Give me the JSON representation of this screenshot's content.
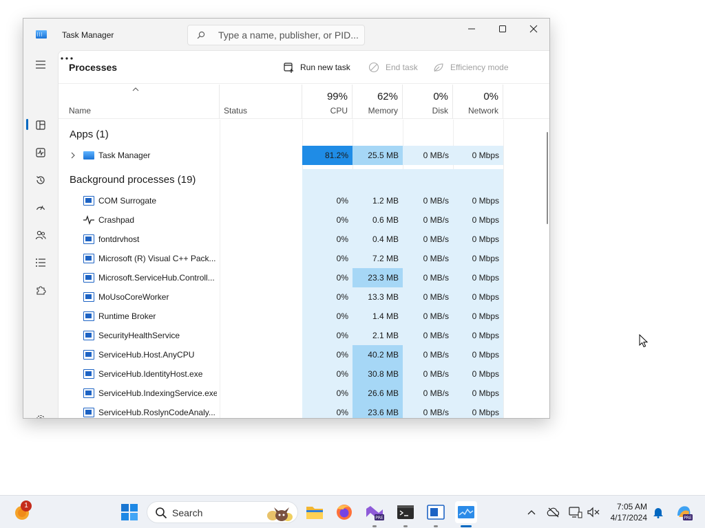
{
  "window": {
    "title": "Task Manager",
    "search_placeholder": "Type a name, publisher, or PID..."
  },
  "commandbar": {
    "page_title": "Processes",
    "run_new_task": "Run new task",
    "end_task": "End task",
    "efficiency_mode": "Efficiency mode"
  },
  "columns": {
    "name": "Name",
    "status": "Status",
    "cpu": {
      "pct": "99%",
      "label": "CPU"
    },
    "memory": {
      "pct": "62%",
      "label": "Memory"
    },
    "disk": {
      "pct": "0%",
      "label": "Disk"
    },
    "network": {
      "pct": "0%",
      "label": "Network"
    }
  },
  "groups": {
    "apps": "Apps (1)",
    "background": "Background processes (19)"
  },
  "apps": [
    {
      "name": "Task Manager",
      "cpu": "81.2%",
      "memory": "25.5 MB",
      "disk": "0 MB/s",
      "network": "0 Mbps"
    }
  ],
  "background": [
    {
      "name": "COM Surrogate",
      "cpu": "0%",
      "memory": "1.2 MB",
      "disk": "0 MB/s",
      "network": "0 Mbps",
      "icon": "process-icon"
    },
    {
      "name": "Crashpad",
      "cpu": "0%",
      "memory": "0.6 MB",
      "disk": "0 MB/s",
      "network": "0 Mbps",
      "icon": "pulse-icon"
    },
    {
      "name": "fontdrvhost",
      "cpu": "0%",
      "memory": "0.4 MB",
      "disk": "0 MB/s",
      "network": "0 Mbps",
      "icon": "process-icon"
    },
    {
      "name": "Microsoft (R) Visual C++ Pack...",
      "cpu": "0%",
      "memory": "7.2 MB",
      "disk": "0 MB/s",
      "network": "0 Mbps",
      "icon": "process-icon"
    },
    {
      "name": "Microsoft.ServiceHub.Controll...",
      "cpu": "0%",
      "memory": "23.3 MB",
      "disk": "0 MB/s",
      "network": "0 Mbps",
      "icon": "process-icon"
    },
    {
      "name": "MoUsoCoreWorker",
      "cpu": "0%",
      "memory": "13.3 MB",
      "disk": "0 MB/s",
      "network": "0 Mbps",
      "icon": "process-icon"
    },
    {
      "name": "Runtime Broker",
      "cpu": "0%",
      "memory": "1.4 MB",
      "disk": "0 MB/s",
      "network": "0 Mbps",
      "icon": "process-icon"
    },
    {
      "name": "SecurityHealthService",
      "cpu": "0%",
      "memory": "2.1 MB",
      "disk": "0 MB/s",
      "network": "0 Mbps",
      "icon": "process-icon"
    },
    {
      "name": "ServiceHub.Host.AnyCPU",
      "cpu": "0%",
      "memory": "40.2 MB",
      "disk": "0 MB/s",
      "network": "0 Mbps",
      "icon": "process-icon"
    },
    {
      "name": "ServiceHub.IdentityHost.exe",
      "cpu": "0%",
      "memory": "30.8 MB",
      "disk": "0 MB/s",
      "network": "0 Mbps",
      "icon": "process-icon"
    },
    {
      "name": "ServiceHub.IndexingService.exe",
      "cpu": "0%",
      "memory": "26.6 MB",
      "disk": "0 MB/s",
      "network": "0 Mbps",
      "icon": "process-icon"
    },
    {
      "name": "ServiceHub.RoslynCodeAnaly...",
      "cpu": "0%",
      "memory": "23.6 MB",
      "disk": "0 MB/s",
      "network": "0 Mbps",
      "icon": "process-icon"
    }
  ],
  "taskbar": {
    "search": "Search",
    "notification_count": "1",
    "time": "7:05 AM",
    "date": "4/17/2024"
  },
  "colors": {
    "accent": "#0067c0",
    "heat_low": "#dff0fb",
    "heat_med": "#a6d7f6",
    "heat_high": "#1f8ce6"
  }
}
